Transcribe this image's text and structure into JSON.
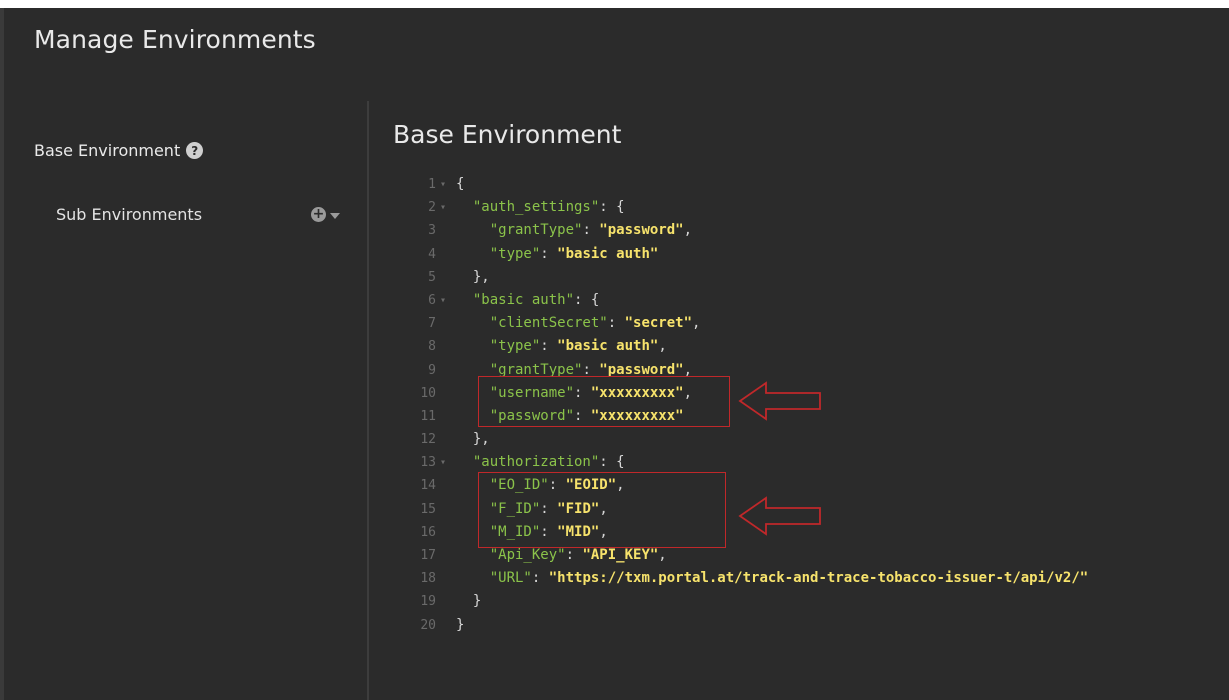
{
  "window": {
    "title": "Manage Environments"
  },
  "sidebar": {
    "base_label": "Base Environment",
    "help_glyph": "?",
    "sub_label": "Sub Environments",
    "add_glyph": "+"
  },
  "main": {
    "title": "Base Environment"
  },
  "highlight_color": "#c0282a",
  "colors": {
    "key": "#8bc34a",
    "string": "#f7e36c",
    "background": "#2b2b2b"
  },
  "editor": {
    "lines": [
      {
        "n": "1",
        "fold": "▾",
        "parts": [
          [
            "p",
            "{"
          ]
        ]
      },
      {
        "n": "2",
        "fold": "▾",
        "parts": [
          [
            "p",
            "  "
          ],
          [
            "k",
            "\"auth_settings\""
          ],
          [
            "p",
            ": {"
          ]
        ]
      },
      {
        "n": "3",
        "fold": "",
        "parts": [
          [
            "p",
            "    "
          ],
          [
            "k",
            "\"grantType\""
          ],
          [
            "p",
            ": "
          ],
          [
            "v",
            "\"password\""
          ],
          [
            "p",
            ","
          ]
        ]
      },
      {
        "n": "4",
        "fold": "",
        "parts": [
          [
            "p",
            "    "
          ],
          [
            "k",
            "\"type\""
          ],
          [
            "p",
            ": "
          ],
          [
            "v",
            "\"basic auth\""
          ]
        ]
      },
      {
        "n": "5",
        "fold": "",
        "parts": [
          [
            "p",
            "  },"
          ]
        ]
      },
      {
        "n": "6",
        "fold": "▾",
        "parts": [
          [
            "p",
            "  "
          ],
          [
            "k",
            "\"basic auth\""
          ],
          [
            "p",
            ": {"
          ]
        ]
      },
      {
        "n": "7",
        "fold": "",
        "parts": [
          [
            "p",
            "    "
          ],
          [
            "k",
            "\"clientSecret\""
          ],
          [
            "p",
            ": "
          ],
          [
            "v",
            "\"secret\""
          ],
          [
            "p",
            ","
          ]
        ]
      },
      {
        "n": "8",
        "fold": "",
        "parts": [
          [
            "p",
            "    "
          ],
          [
            "k",
            "\"type\""
          ],
          [
            "p",
            ": "
          ],
          [
            "v",
            "\"basic auth\""
          ],
          [
            "p",
            ","
          ]
        ]
      },
      {
        "n": "9",
        "fold": "",
        "parts": [
          [
            "p",
            "    "
          ],
          [
            "k",
            "\"grantType\""
          ],
          [
            "p",
            ": "
          ],
          [
            "v",
            "\"password\""
          ],
          [
            "p",
            ","
          ]
        ]
      },
      {
        "n": "10",
        "fold": "",
        "parts": [
          [
            "p",
            "    "
          ],
          [
            "k",
            "\"username\""
          ],
          [
            "p",
            ": "
          ],
          [
            "v",
            "\"xxxxxxxxx\""
          ],
          [
            "p",
            ","
          ]
        ]
      },
      {
        "n": "11",
        "fold": "",
        "parts": [
          [
            "p",
            "    "
          ],
          [
            "k",
            "\"password\""
          ],
          [
            "p",
            ": "
          ],
          [
            "v",
            "\"xxxxxxxxx\""
          ]
        ]
      },
      {
        "n": "12",
        "fold": "",
        "parts": [
          [
            "p",
            "  },"
          ]
        ]
      },
      {
        "n": "13",
        "fold": "▾",
        "parts": [
          [
            "p",
            "  "
          ],
          [
            "k",
            "\"authorization\""
          ],
          [
            "p",
            ": {"
          ]
        ]
      },
      {
        "n": "14",
        "fold": "",
        "parts": [
          [
            "p",
            "    "
          ],
          [
            "k",
            "\"EO_ID\""
          ],
          [
            "p",
            ": "
          ],
          [
            "v",
            "\"EOID\""
          ],
          [
            "p",
            ","
          ]
        ]
      },
      {
        "n": "15",
        "fold": "",
        "parts": [
          [
            "p",
            "    "
          ],
          [
            "k",
            "\"F_ID\""
          ],
          [
            "p",
            ": "
          ],
          [
            "v",
            "\"FID\""
          ],
          [
            "p",
            ","
          ]
        ]
      },
      {
        "n": "16",
        "fold": "",
        "parts": [
          [
            "p",
            "    "
          ],
          [
            "k",
            "\"M_ID\""
          ],
          [
            "p",
            ": "
          ],
          [
            "v",
            "\"MID\""
          ],
          [
            "p",
            ","
          ]
        ]
      },
      {
        "n": "17",
        "fold": "",
        "parts": [
          [
            "p",
            "    "
          ],
          [
            "k",
            "\"Api_Key\""
          ],
          [
            "p",
            ": "
          ],
          [
            "v",
            "\"API_KEY\""
          ],
          [
            "p",
            ","
          ]
        ]
      },
      {
        "n": "18",
        "fold": "",
        "parts": [
          [
            "p",
            "    "
          ],
          [
            "k",
            "\"URL\""
          ],
          [
            "p",
            ": "
          ],
          [
            "v",
            "\"https://txm.portal.at/track-and-trace-tobacco-issuer-t/api/v2/\""
          ]
        ]
      },
      {
        "n": "19",
        "fold": "",
        "parts": [
          [
            "p",
            "  }"
          ]
        ]
      },
      {
        "n": "20",
        "fold": "",
        "parts": [
          [
            "p",
            "}"
          ]
        ]
      }
    ]
  }
}
